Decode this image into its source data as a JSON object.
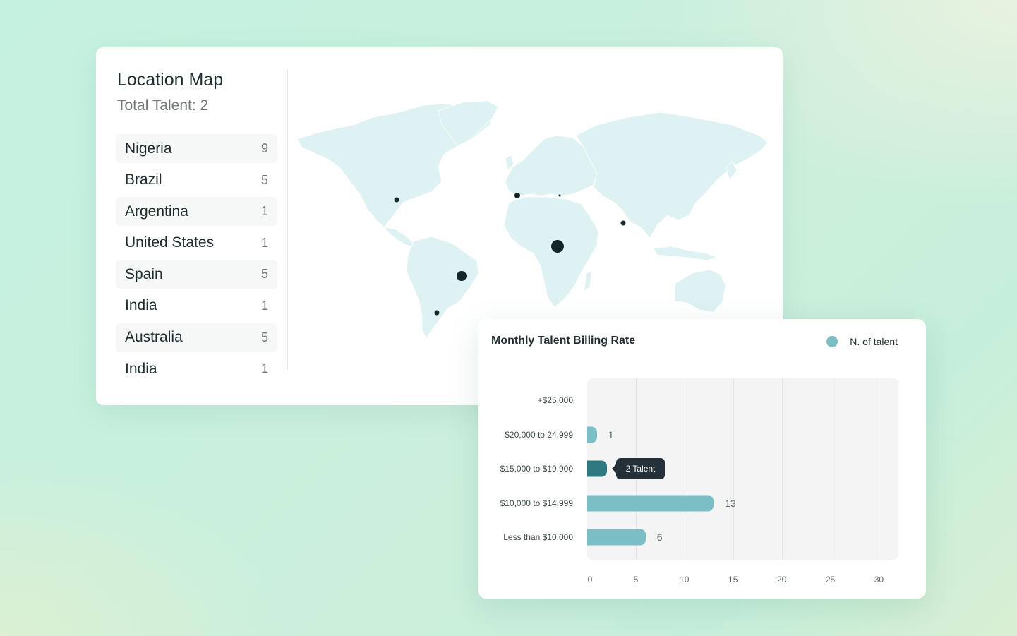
{
  "location_map": {
    "title": "Location Map",
    "subtitle": "Total Talent: 2",
    "countries": [
      {
        "name": "Nigeria",
        "count": "9"
      },
      {
        "name": "Brazil",
        "count": "5"
      },
      {
        "name": "Argentina",
        "count": "1"
      },
      {
        "name": "United States",
        "count": "1"
      },
      {
        "name": "Spain",
        "count": "5"
      },
      {
        "name": "India",
        "count": "1"
      },
      {
        "name": "Australia",
        "count": "5"
      },
      {
        "name": "India",
        "count": "1"
      }
    ]
  },
  "billing": {
    "title": "Monthly Talent Billing Rate",
    "legend_label": "N. of talent",
    "tooltip": "2 Talent",
    "accent": "#7bbec6",
    "active_color": "#2f7a80"
  },
  "chart_data": {
    "type": "bar",
    "orientation": "horizontal",
    "title": "Monthly Talent Billing Rate",
    "categories": [
      "+$25,000",
      "$20,000 to 24,999",
      "$15,000 to $19,900",
      "$10,000 to $14,999",
      "Less than $10,000"
    ],
    "series": [
      {
        "name": "N. of talent",
        "values": [
          0,
          1,
          2,
          13,
          6
        ]
      }
    ],
    "data_labels": [
      "",
      "1",
      "",
      "13",
      "6"
    ],
    "highlighted_index": 2,
    "xlim": [
      0,
      32
    ],
    "xticks": [
      "0",
      "5",
      "10",
      "15",
      "20",
      "25",
      "30"
    ],
    "grid": true,
    "legend": "top-right"
  }
}
